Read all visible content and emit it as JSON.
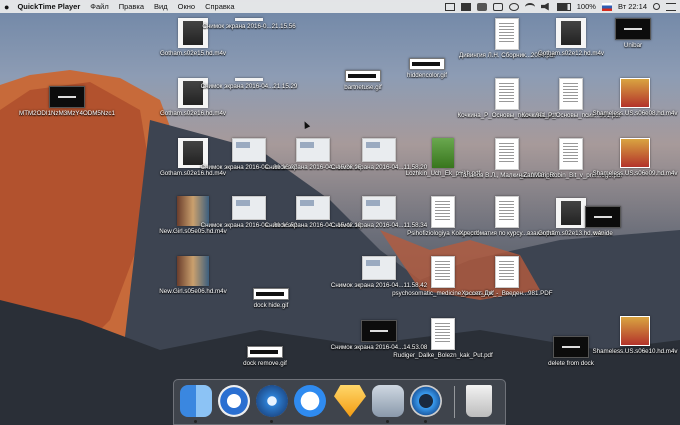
{
  "menubar": {
    "app_name": "QuickTime Player",
    "menus": [
      "Файл",
      "Правка",
      "Вид",
      "Окно",
      "Справка"
    ],
    "battery": "100%",
    "clock": "Вт 22:14"
  },
  "desktop": {
    "icons": [
      {
        "label": "Gotham.s02e15.hd.m4v",
        "type": "movie"
      },
      {
        "label": "Снимок экрана 2016-0...21.15.56",
        "type": "bar"
      },
      {
        "label": "MTM2ODI1NzM3MzY4ODM5Nzc1",
        "type": "dark"
      },
      {
        "label": "Gotham.s02e16.hd.m4v",
        "type": "movie"
      },
      {
        "label": "Снимок экрана 2016-04...21.15.29",
        "type": "bar"
      },
      {
        "label": "bartnetuse.gif",
        "type": "gif"
      },
      {
        "label": "hiddencolor.gif",
        "type": "gif"
      },
      {
        "label": "Gotham.s02e16.hd.m4v",
        "type": "movie"
      },
      {
        "label": "Снимок экрана 2016-04...21.16.37",
        "type": "shot"
      },
      {
        "label": "Снимок экрана 2016-04...15.36.05",
        "type": "shot"
      },
      {
        "label": "Снимок экрана 2016-04...11.58.20",
        "type": "shot"
      },
      {
        "label": "New.Girl.s05e05.hd.m4v",
        "type": "girl"
      },
      {
        "label": "Снимок экрана 2016-04...21.16.52",
        "type": "shot"
      },
      {
        "label": "Снимок экрана 2016-04...15.42.10",
        "type": "shot"
      },
      {
        "label": "Снимок экрана 2016-04...11.58.34",
        "type": "shot"
      },
      {
        "label": "New.Girl.s05e06.hd.m4v",
        "type": "girl"
      },
      {
        "label": "dock hide.gif",
        "type": "gif"
      },
      {
        "label": "Снимок экрана 2016-04...11.58.42",
        "type": "shot"
      },
      {
        "label": "dock remove.gif",
        "type": "gif"
      },
      {
        "label": "Снимок экрана 2016-04...14.53.08",
        "type": "dark"
      },
      {
        "label": "Lozhkin_Uch_Ek_psikh.pdf",
        "type": "book"
      },
      {
        "label": "Psihofiziologiya Kokyn.pdf",
        "type": "doc"
      },
      {
        "label": "psychosomatic_medicine_p...uss.Pdf",
        "type": "doc"
      },
      {
        "label": "Rudiger_Dalke_Bolezn_kak_Put.pdf",
        "type": "doc"
      },
      {
        "label": "Дивингия Л.Н. Сборник...2004.pdf",
        "type": "doc"
      },
      {
        "label": "Кочкина_Р_Основы_псих...991.pdf",
        "type": "doc"
      },
      {
        "label": "Таланов В.Л., Малкина...2006.pdf",
        "type": "doc"
      },
      {
        "label": "Хрестоматия по курсу...взаим.pdf",
        "type": "doc"
      },
      {
        "label": "Хэссет_Дж_-_Введен...981.PDF",
        "type": "doc"
      },
      {
        "label": "Gotham.s02e12.hd.m4v",
        "type": "movie"
      },
      {
        "label": "Кочкина_Р_Основы_псих...991.pdf",
        "type": "doc"
      },
      {
        "label": "_ZanMari_Robin_Bit_v_pris...ogo.pdf",
        "type": "doc"
      },
      {
        "label": "Gotham.s02e13.hd.m4v",
        "type": "movie"
      },
      {
        "label": "Unibar",
        "type": "dark"
      },
      {
        "label": "Shameless.US.s06e08.hd.m4v",
        "type": "show"
      },
      {
        "label": "Shameless.US.s06e09.hd.m4v",
        "type": "show"
      },
      {
        "label": "wanide",
        "type": "dark"
      },
      {
        "label": "delete from dock",
        "type": "dark"
      },
      {
        "label": "Shameless.US.s06e10.hd.m4v",
        "type": "show"
      }
    ]
  },
  "dock": {
    "apps": [
      "finder-icon",
      "1password-icon",
      "safari-icon",
      "messages-icon",
      "sketch-icon",
      "preview-icon",
      "quicktime-icon",
      "trash-icon"
    ]
  }
}
